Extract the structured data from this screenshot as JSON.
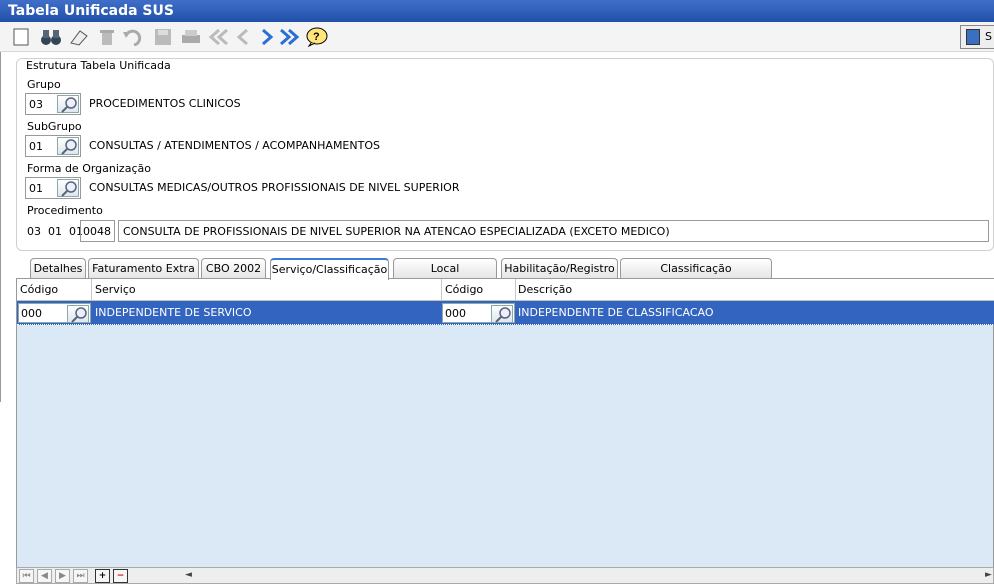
{
  "window": {
    "title": "Tabela Unificada SUS"
  },
  "toolbar": {
    "buttons": [
      "new-icon",
      "search-binoculars-icon",
      "edit-eraser-icon",
      "delete-trash-icon",
      "undo-icon",
      "save-icon",
      "print-icon",
      "first-record-icon",
      "previous-record-icon",
      "next-record-icon",
      "last-record-icon",
      "help-icon"
    ],
    "exit_label": "S"
  },
  "form": {
    "legend": "Estrutura Tabela Unificada",
    "grupo": {
      "label": "Grupo",
      "code": "03",
      "description": "PROCEDIMENTOS CLINICOS"
    },
    "subgrupo": {
      "label": "SubGrupo",
      "code": "01",
      "description": "CONSULTAS / ATENDIMENTOS / ACOMPANHAMENTOS"
    },
    "forma": {
      "label": "Forma de Organização",
      "code": "01",
      "description": "CONSULTAS MEDICAS/OUTROS PROFISSIONAIS  DE NIVEL SUPERIOR"
    },
    "procedimento": {
      "label": "Procedimento",
      "prefix": "03  01  01",
      "code": "0048",
      "description": "CONSULTA DE PROFISSIONAIS DE NIVEL SUPERIOR NA ATENCAO ESPECIALIZADA (EXCETO MEDICO)"
    }
  },
  "tabs": [
    "Detalhes",
    "Faturamento Extra",
    "CBO 2002",
    "Serviço/Classificação",
    "Local Atendimento",
    "Habilitação/Registro",
    "Classificação Procedimento"
  ],
  "active_tab": "Serviço/Classificação",
  "grid": {
    "headers": [
      "Código",
      "Serviço",
      "Código",
      "Descrição"
    ],
    "rows": [
      {
        "servico_code": "000",
        "servico": "INDEPENDENTE DE SERVICO",
        "class_code": "000",
        "descricao": "INDEPENDENTE DE CLASSIFICACAO"
      }
    ]
  },
  "navigator": {
    "first": "⏮",
    "prev": "◀",
    "next": "▶",
    "last": "⏭",
    "add": "+",
    "remove": "−",
    "scroll_left": "◄",
    "scroll_right": "►"
  }
}
